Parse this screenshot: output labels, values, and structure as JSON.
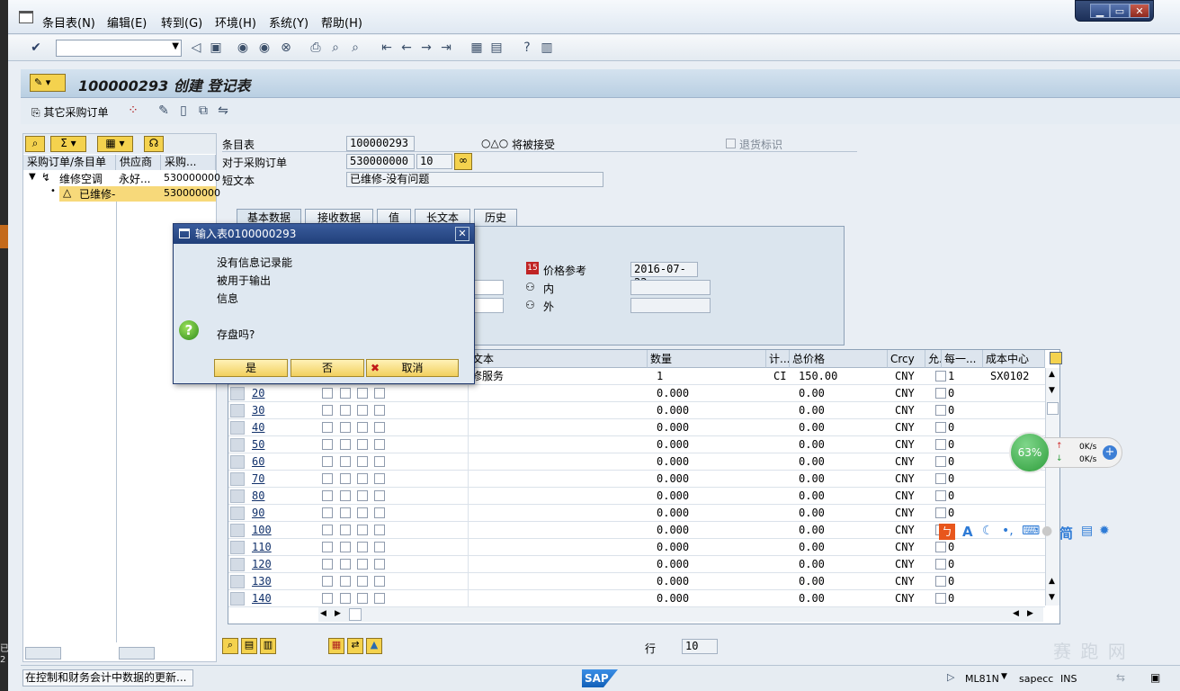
{
  "menu": [
    "条目表(N)",
    "编辑(E)",
    "转到(G)",
    "环境(H)",
    "系统(Y)",
    "帮助(H)"
  ],
  "window_controls": {
    "minimize": "▁",
    "restore": "▭",
    "close": "✕"
  },
  "title": "100000293 创建 登记表",
  "app_toolbar": {
    "other_po": "其它采购订单"
  },
  "tree": {
    "headers": [
      "采购订单/条目单",
      "供应商",
      "采购..."
    ],
    "rows": [
      {
        "name": "维修空调",
        "vendor": "永好...",
        "po": "530000000"
      },
      {
        "name": "已维修-",
        "vendor": "",
        "po": "530000000"
      }
    ]
  },
  "header": {
    "entry_sheet_label": "条目表",
    "entry_sheet": "100000293",
    "status": "将被接受",
    "return_flag": "退货标识",
    "po_label": "对于采购订单",
    "po": "530000000",
    "po_item": "10",
    "short_text_label": "短文本",
    "short_text": "已维修-没有问题"
  },
  "tabs": [
    "基本数据",
    "接收数据",
    "值",
    "长文本",
    "历史"
  ],
  "price_ref": {
    "label": "价格参考",
    "date": "2016-07-22",
    "inner_label": "内",
    "outer_label": "外"
  },
  "grid": {
    "headers": [
      "文本",
      "数量",
      "计...",
      "总价格",
      "Crcy",
      "允...",
      "每一...",
      "成本中心"
    ],
    "first_row": {
      "text": "修服务",
      "qty": "1",
      "unit": "CI",
      "price": "150.00",
      "crcy": "CNY",
      "per": "1",
      "cost_center": "SX0102"
    },
    "lines": [
      {
        "line": "20",
        "qty": "0.000",
        "price": "0.00",
        "crcy": "CNY",
        "per": "0"
      },
      {
        "line": "30",
        "qty": "0.000",
        "price": "0.00",
        "crcy": "CNY",
        "per": "0"
      },
      {
        "line": "40",
        "qty": "0.000",
        "price": "0.00",
        "crcy": "CNY",
        "per": "0"
      },
      {
        "line": "50",
        "qty": "0.000",
        "price": "0.00",
        "crcy": "CNY",
        "per": "0"
      },
      {
        "line": "60",
        "qty": "0.000",
        "price": "0.00",
        "crcy": "CNY",
        "per": "0"
      },
      {
        "line": "70",
        "qty": "0.000",
        "price": "0.00",
        "crcy": "CNY",
        "per": "0"
      },
      {
        "line": "80",
        "qty": "0.000",
        "price": "0.00",
        "crcy": "CNY",
        "per": "0"
      },
      {
        "line": "90",
        "qty": "0.000",
        "price": "0.00",
        "crcy": "CNY",
        "per": "0"
      },
      {
        "line": "100",
        "qty": "0.000",
        "price": "0.00",
        "crcy": "CNY",
        "per": "0"
      },
      {
        "line": "110",
        "qty": "0.000",
        "price": "0.00",
        "crcy": "CNY",
        "per": "0"
      },
      {
        "line": "120",
        "qty": "0.000",
        "price": "0.00",
        "crcy": "CNY",
        "per": "0"
      },
      {
        "line": "130",
        "qty": "0.000",
        "price": "0.00",
        "crcy": "CNY",
        "per": "0"
      },
      {
        "line": "140",
        "qty": "0.000",
        "price": "0.00",
        "crcy": "CNY",
        "per": "0"
      }
    ],
    "row_label": "行",
    "row_value": "10"
  },
  "dialog": {
    "title": "输入表0100000293",
    "lines": [
      "没有信息记录能",
      "被用于输出",
      "信息"
    ],
    "question": "存盘吗?",
    "yes": "是",
    "no": "否",
    "cancel": "取消"
  },
  "status_bar": {
    "message": "在控制和财务会计中数据的更新...",
    "brand": "SAP",
    "tcode": "ML81N",
    "server": "sapecc",
    "mode": "INS"
  },
  "net_widget": {
    "percent": "63%",
    "up": "0K/s",
    "down": "0K/s"
  },
  "ime_bar": {
    "simplified": "简"
  },
  "left_edge": [
    "已",
    "2"
  ],
  "watermark": "赛 跑 网",
  "colors": {
    "title_bg": "#c3d6e8",
    "dialog_title": "#2c4c8a",
    "button_yellow": "#f2cf5e",
    "net_green": "#2f9e3c"
  }
}
